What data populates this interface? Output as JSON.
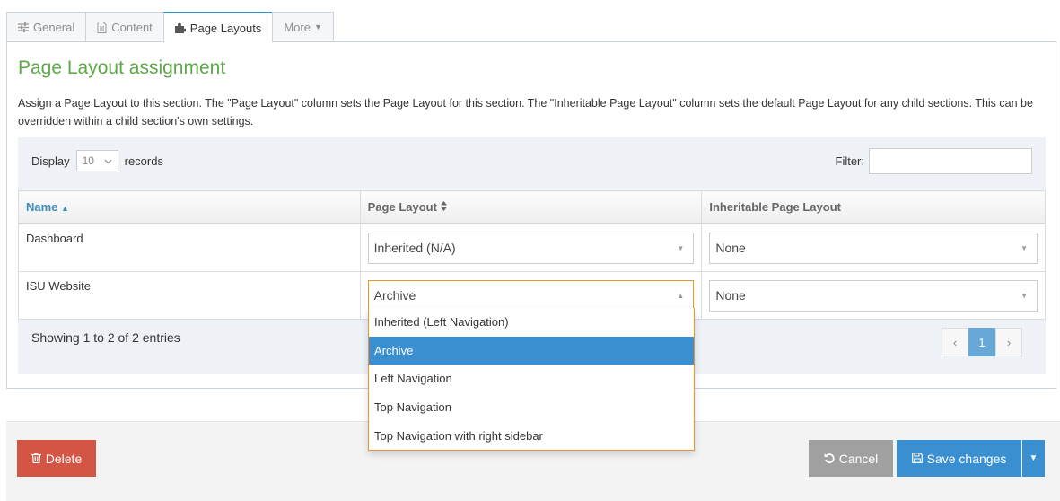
{
  "tabs": [
    {
      "label": "General",
      "icon": "sliders-icon"
    },
    {
      "label": "Content",
      "icon": "document-icon"
    },
    {
      "label": "Page Layouts",
      "icon": "puzzle-icon",
      "active": true
    },
    {
      "label": "More",
      "icon": "caret-down-icon"
    }
  ],
  "page": {
    "title": "Page Layout assignment",
    "description": "Assign a Page Layout to this section. The \"Page Layout\" column sets the Page Layout for this section. The \"Inheritable Page Layout\" column sets the default Page Layout for any child sections. This can be overridden within a child section's own settings."
  },
  "table_controls": {
    "display_label": "Display",
    "records_label": "records",
    "page_length": "10",
    "filter_label": "Filter:",
    "filter_value": ""
  },
  "table": {
    "columns": [
      {
        "label": "Name",
        "sort": "asc"
      },
      {
        "label": "Page Layout",
        "sort": "both"
      },
      {
        "label": "Inheritable Page Layout"
      }
    ],
    "rows": [
      {
        "name": "Dashboard",
        "page_layout": "Inherited (N/A)",
        "inheritable": "None"
      },
      {
        "name": "ISU Website",
        "page_layout": "Archive",
        "inheritable": "None"
      }
    ]
  },
  "dropdown": {
    "options": [
      "Inherited (Left Navigation)",
      "Archive",
      "Left Navigation",
      "Top Navigation",
      "Top Navigation with right sidebar"
    ],
    "highlighted": "Archive"
  },
  "pagination": {
    "info": "Showing 1 to 2 of 2 entries",
    "prev": "‹",
    "current": "1",
    "next": "›"
  },
  "footer": {
    "delete_label": "Delete",
    "cancel_label": "Cancel",
    "save_label": "Save changes"
  },
  "colors": {
    "title_green": "#5fa84a",
    "primary_blue": "#3a8fd1",
    "danger_red": "#d35644",
    "focus_orange": "#f0922f"
  }
}
